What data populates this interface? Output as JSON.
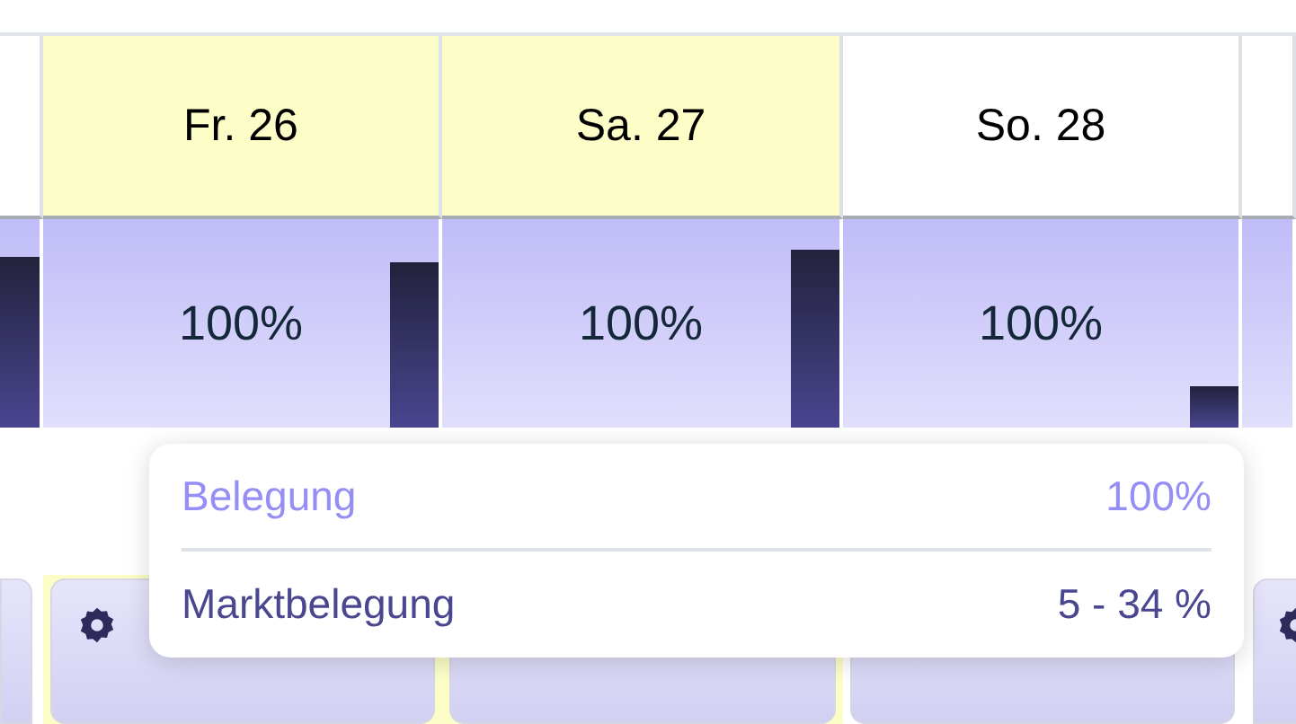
{
  "days": [
    {
      "highlighted": false,
      "settings_icon": false
    },
    {
      "label": "Fr. 26",
      "highlighted": true,
      "occupancy": "100%",
      "settings_icon": true
    },
    {
      "label": "Sa. 27",
      "highlighted": true,
      "occupancy": "100%",
      "settings_icon": false
    },
    {
      "label": "So. 28",
      "highlighted": false,
      "occupancy": "100%",
      "settings_icon": false
    },
    {
      "highlighted": false,
      "settings_icon": true
    }
  ],
  "tooltip": {
    "rows": [
      {
        "kind": "occupancy",
        "label": "Belegung",
        "value": "100%"
      },
      {
        "kind": "market",
        "label": "Marktbelegung",
        "value": "5 - 34 %"
      }
    ]
  }
}
